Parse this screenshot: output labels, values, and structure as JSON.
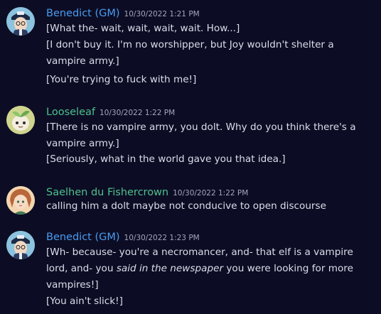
{
  "colors": {
    "background": "#0c0d24",
    "gm_name": "#4b9cf0",
    "looseleaf_name": "#4fc08d",
    "saelhen_name": "#4fc08d",
    "timestamp": "#a3a6bd",
    "message_text": "#dcddea"
  },
  "messages": [
    {
      "author": "Benedict (GM)",
      "avatar": "benedict-avatar",
      "timestamp": "10/30/2022 1:21 PM",
      "lines": [
        "[What the- wait, wait, wait, wait. How...]",
        "[I don't buy it. I'm no worshipper, but Joy wouldn't shelter a vampire army.]",
        "[You're trying to fuck with me!]"
      ]
    },
    {
      "author": "Looseleaf",
      "avatar": "looseleaf-avatar",
      "timestamp": "10/30/2022 1:22 PM",
      "lines": [
        "[There is no vampire army, you dolt. Why do you think there's a vampire army.]",
        "[Seriously, what in the world gave you that idea.]"
      ]
    },
    {
      "author": "Saelhen du Fishercrown",
      "avatar": "saelhen-avatar",
      "timestamp": "10/30/2022 1:22 PM",
      "lines": [
        "calling him a dolt maybe not conducive to open discourse"
      ]
    },
    {
      "author": "Benedict (GM)",
      "avatar": "benedict-avatar",
      "timestamp": "10/30/2022 1:23 PM",
      "lines_rich": [
        {
          "before": "[Wh- because- you're a necromancer, and- that elf is a vampire lord, and- you ",
          "italic": "said in the newspaper",
          "after": " you were looking for more vampires!]"
        }
      ],
      "lines": [
        "[You ain't slick!]"
      ]
    }
  ]
}
